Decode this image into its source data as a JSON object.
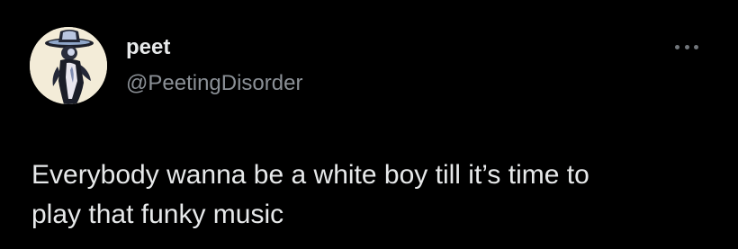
{
  "author": {
    "display_name": "peet",
    "handle": "@PeetingDisorder",
    "avatar_icon": "cowboy-figure-avatar-icon"
  },
  "more_icon": "more-options-icon",
  "tweet": {
    "lines": [
      "Everybody wanna be a white boy till it’s time to",
      "play that funky music"
    ]
  },
  "colors": {
    "background": "#000000",
    "text_primary": "#e7e9ea",
    "text_secondary": "#8b9096",
    "icon_muted": "#71767b"
  }
}
